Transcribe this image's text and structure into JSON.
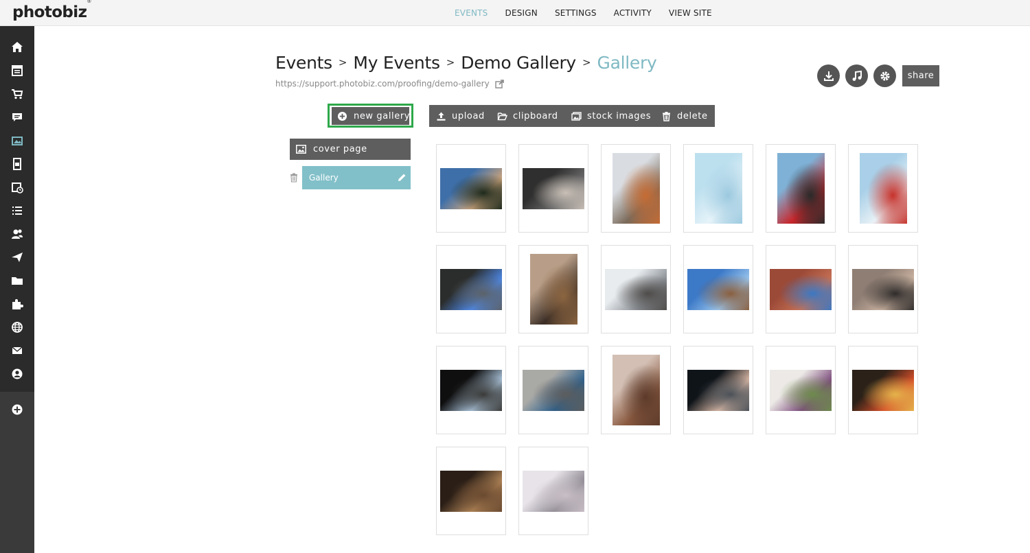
{
  "app": {
    "logo": "photobiz",
    "logo_mark": "®"
  },
  "nav": [
    "EVENTS",
    "DESIGN",
    "SETTINGS",
    "ACTIVITY",
    "VIEW SITE"
  ],
  "breadcrumb": {
    "items": [
      "Events",
      "My Events",
      "Demo Gallery"
    ],
    "current": "Gallery",
    "separator": ">"
  },
  "url": "https://support.photobiz.com/proofing/demo-gallery",
  "header_actions": {
    "share_label": "share",
    "icons": [
      "download-icon",
      "music-icon",
      "gear-icon"
    ]
  },
  "toolbar": {
    "new_gallery": "new gallery",
    "upload": "upload",
    "clipboard": "clipboard",
    "stock_images": "stock images",
    "delete": "delete"
  },
  "left_panel": {
    "cover_page": "cover page",
    "gallery_item": "Gallery"
  },
  "sidebar_icons": [
    "home-icon",
    "calendar-icon",
    "cart-icon",
    "chat-icon",
    "gallery-icon",
    "invoice-icon",
    "schedule-icon",
    "list-icon",
    "contacts-icon",
    "send-icon",
    "folder-icon",
    "puzzle-icon",
    "globe-icon",
    "mail-icon",
    "account-icon",
    "add-icon"
  ],
  "colors": {
    "accent": "#7fb9c3",
    "button": "#5e5e5e",
    "highlight_border": "#2ea84a",
    "sidebar": "#2b2b2b"
  },
  "thumbnails": [
    {
      "orientation": "landscape",
      "colors": [
        "#3f6fa8",
        "#c9a37c",
        "#1e2a1c"
      ]
    },
    {
      "orientation": "landscape",
      "colors": [
        "#2f2f2f",
        "#6b6b6b",
        "#c9c0b7"
      ]
    },
    {
      "orientation": "portrait",
      "colors": [
        "#d9dde2",
        "#7a6a5a",
        "#c56b33"
      ]
    },
    {
      "orientation": "portrait",
      "colors": [
        "#bde0ef",
        "#e6f3f9",
        "#9bc9df"
      ]
    },
    {
      "orientation": "portrait",
      "colors": [
        "#7fb1d6",
        "#c8262b",
        "#2a2a2a"
      ]
    },
    {
      "orientation": "portrait",
      "colors": [
        "#a9d0e8",
        "#e8f1f6",
        "#c7322b"
      ]
    },
    {
      "orientation": "landscape",
      "colors": [
        "#2b2d2c",
        "#4d88e6",
        "#5c6269"
      ]
    },
    {
      "orientation": "portrait",
      "colors": [
        "#b89e88",
        "#3b2e26",
        "#8c6540"
      ]
    },
    {
      "orientation": "landscape",
      "colors": [
        "#e8ecef",
        "#8a8f95",
        "#4f4c4a"
      ]
    },
    {
      "orientation": "landscape",
      "colors": [
        "#3c79c7",
        "#9ac5ec",
        "#8a5f3e"
      ]
    },
    {
      "orientation": "landscape",
      "colors": [
        "#9c4a38",
        "#c67155",
        "#3c78c3"
      ]
    },
    {
      "orientation": "landscape",
      "colors": [
        "#8f7e74",
        "#c9b2a0",
        "#2e2b2a"
      ]
    },
    {
      "orientation": "landscape",
      "colors": [
        "#0f0f10",
        "#a9c2d8",
        "#3a3a38"
      ]
    },
    {
      "orientation": "landscape",
      "colors": [
        "#a9a9a6",
        "#2c5e8a",
        "#5d5d5d"
      ]
    },
    {
      "orientation": "portrait",
      "colors": [
        "#d3bfb4",
        "#8a5a40",
        "#5c3a2a"
      ]
    },
    {
      "orientation": "landscape",
      "colors": [
        "#0f1419",
        "#d9b8a6",
        "#4a5158"
      ]
    },
    {
      "orientation": "landscape",
      "colors": [
        "#ece9e6",
        "#7d4c7d",
        "#6d8b4c"
      ]
    },
    {
      "orientation": "landscape",
      "colors": [
        "#2b2118",
        "#d64f2a",
        "#e5b34b"
      ]
    },
    {
      "orientation": "landscape",
      "colors": [
        "#2a1e16",
        "#b08457",
        "#6a4a30"
      ]
    },
    {
      "orientation": "landscape",
      "colors": [
        "#e7e3e8",
        "#8f8a94",
        "#c9bfc6"
      ]
    }
  ]
}
